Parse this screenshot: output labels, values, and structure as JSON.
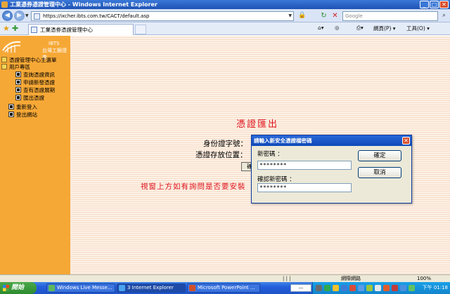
{
  "window": {
    "title": "工業憑券憑證管理中心 - Windows Internet Explorer",
    "min": "_",
    "max": "□",
    "close": "✕"
  },
  "address": {
    "url": "https://ixcher.ibts.com.tw/CACT/default.asp",
    "search_placeholder": "Google"
  },
  "tabbar": {
    "tab_title": "工業憑券憑證管理中心",
    "page_label": "網頁(P) ▾",
    "tools_label": "工具(O) ▾"
  },
  "sidebar": {
    "logo_line1": "IBTS",
    "logo_line2": "台灣工銀證券",
    "items": [
      {
        "label": "憑證管理中心主選單",
        "icon": "folder-icon"
      },
      {
        "label": "用戶專區",
        "icon": "folder-icon"
      },
      {
        "label": "查詢憑證資訊",
        "icon": "document-icon"
      },
      {
        "label": "申請新發憑證",
        "icon": "document-icon"
      },
      {
        "label": "查有憑證展期",
        "icon": "document-icon"
      },
      {
        "label": "匯出憑證",
        "icon": "document-icon"
      },
      {
        "label": "重新登入",
        "icon": "document-icon"
      },
      {
        "label": "登出網站",
        "icon": "document-icon"
      }
    ]
  },
  "main": {
    "title": "憑證匯出",
    "id_label": "身份證字號：",
    "storage_label": "憑證存放位置：",
    "button_label": "確",
    "note": "視窗上方如有詢問是否要安裝"
  },
  "dialog": {
    "title": "請輸入新安全憑證檔密碼",
    "new_password_label": "新密碼 ：",
    "new_password_value": "********",
    "confirm_password_label": "確認新密碼 ：",
    "confirm_password_value": "********",
    "ok_label": "確定",
    "cancel_label": "取消"
  },
  "statusbar": {
    "zone": "網際網路",
    "zoom": "100%"
  },
  "taskbar": {
    "start_label": "開始",
    "items": [
      {
        "label": "Windows Live Messe..."
      },
      {
        "label": "3 Internet Explorer"
      },
      {
        "label": "Microsoft PowerPoint ..."
      }
    ],
    "clock": "下午 01:18"
  }
}
